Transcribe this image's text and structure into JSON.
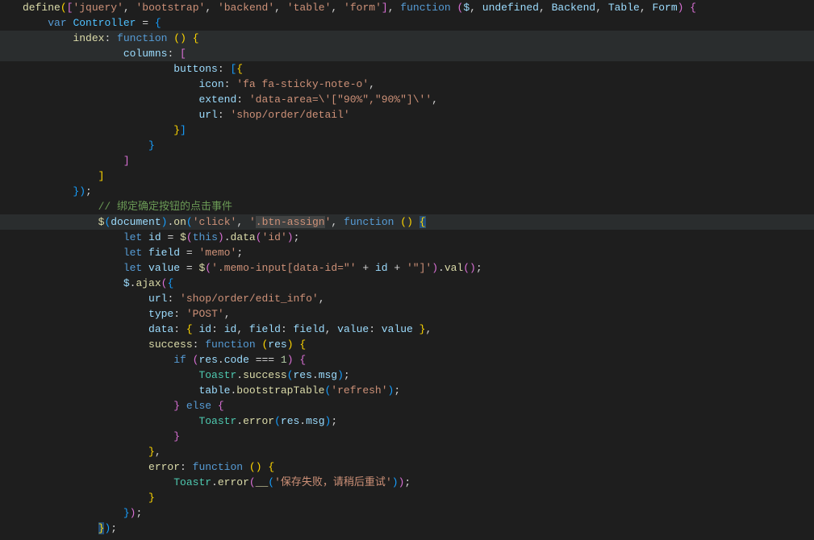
{
  "code": {
    "l1_define": "define",
    "l1_modules": [
      "jquery",
      "bootstrap",
      "backend",
      "table",
      "form"
    ],
    "l1_func_params": [
      "$",
      "undefined",
      "Backend",
      "Table",
      "Form"
    ],
    "l2_var": "var",
    "l2_controller": "Controller",
    "l3_index": "index",
    "l3_function": "function",
    "l4_columns": "columns",
    "l5_buttons": "buttons",
    "l6_icon_key": "icon",
    "l6_icon_val": "fa fa-sticky-note-o",
    "l7_extend_key": "extend",
    "l7_extend_val": "data-area=\\'[\"90%\",\"90%\"]\\'",
    "l8_url_key": "url",
    "l8_url_val": "shop/order/detail",
    "l14_comment": "// 绑定确定按钮的点击事件",
    "l15_doc": "document",
    "l15_on": "on",
    "l15_click": "click",
    "l15_btnassign": ".btn-assign",
    "l15_function": "function",
    "l16_let": "let",
    "l16_id": "id",
    "l16_this": "this",
    "l16_data": "data",
    "l16_idstr": "id",
    "l17_let": "let",
    "l17_field": "field",
    "l17_memo": "memo",
    "l18_let": "let",
    "l18_value": "value",
    "l18_selector": ".memo-input[data-id=\"",
    "l18_id": "id",
    "l18_suffix": "\"]",
    "l18_val": "val",
    "l19_ajax": "ajax",
    "l20_url_key": "url",
    "l20_url_val": "shop/order/edit_info",
    "l21_type_key": "type",
    "l21_type_val": "POST",
    "l22_data_key": "data",
    "l22_id_key": "id",
    "l22_id_val": "id",
    "l22_field_key": "field",
    "l22_field_val": "field",
    "l22_value_key": "value",
    "l22_value_val": "value",
    "l23_success": "success",
    "l23_function": "function",
    "l23_res": "res",
    "l24_if": "if",
    "l24_res": "res",
    "l24_code": "code",
    "l24_1": "1",
    "l25_toastr": "Toastr",
    "l25_success": "success",
    "l25_res": "res",
    "l25_msg": "msg",
    "l26_table": "table",
    "l26_bootstrap": "bootstrapTable",
    "l26_refresh": "refresh",
    "l27_else": "else",
    "l28_toastr": "Toastr",
    "l28_error": "error",
    "l28_res": "res",
    "l28_msg": "msg",
    "l31_error_key": "error",
    "l31_function": "function",
    "l32_toastr": "Toastr",
    "l32_error": "error",
    "l32_msg": "保存失败，请稍后重试"
  }
}
